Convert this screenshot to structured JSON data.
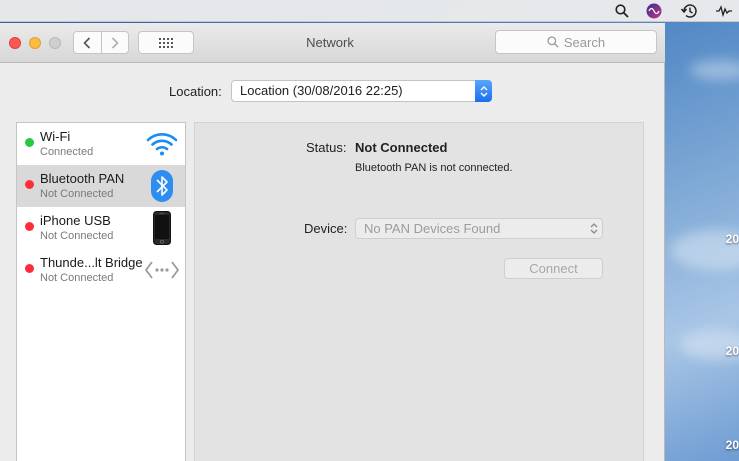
{
  "window": {
    "title": "Network",
    "search_placeholder": "Search"
  },
  "location": {
    "label": "Location:",
    "value": "Location (30/08/2016 22:25)"
  },
  "services": [
    {
      "name": "Wi-Fi",
      "status": "Connected",
      "dot_color": "#28c840",
      "icon": "wifi-icon"
    },
    {
      "name": "Bluetooth PAN",
      "status": "Not Connected",
      "dot_color": "#ff2d3a",
      "icon": "bluetooth-icon"
    },
    {
      "name": "iPhone USB",
      "status": "Not Connected",
      "dot_color": "#ff2d3a",
      "icon": "iphone-icon"
    },
    {
      "name": "Thunde...lt Bridge",
      "status": "Not Connected",
      "dot_color": "#ff2d3a",
      "icon": "thunderbolt-bridge-icon"
    }
  ],
  "detail": {
    "status_label": "Status:",
    "status_value": "Not Connected",
    "status_description": "Bluetooth PAN is not connected.",
    "device_label": "Device:",
    "device_value": "No PAN Devices Found",
    "connect_label": "Connect"
  },
  "desktop_labels": [
    "20",
    "20",
    "20"
  ],
  "colors": {
    "accent": "#1a6ff0",
    "connected": "#28c840",
    "disconnected": "#ff2d3a"
  }
}
